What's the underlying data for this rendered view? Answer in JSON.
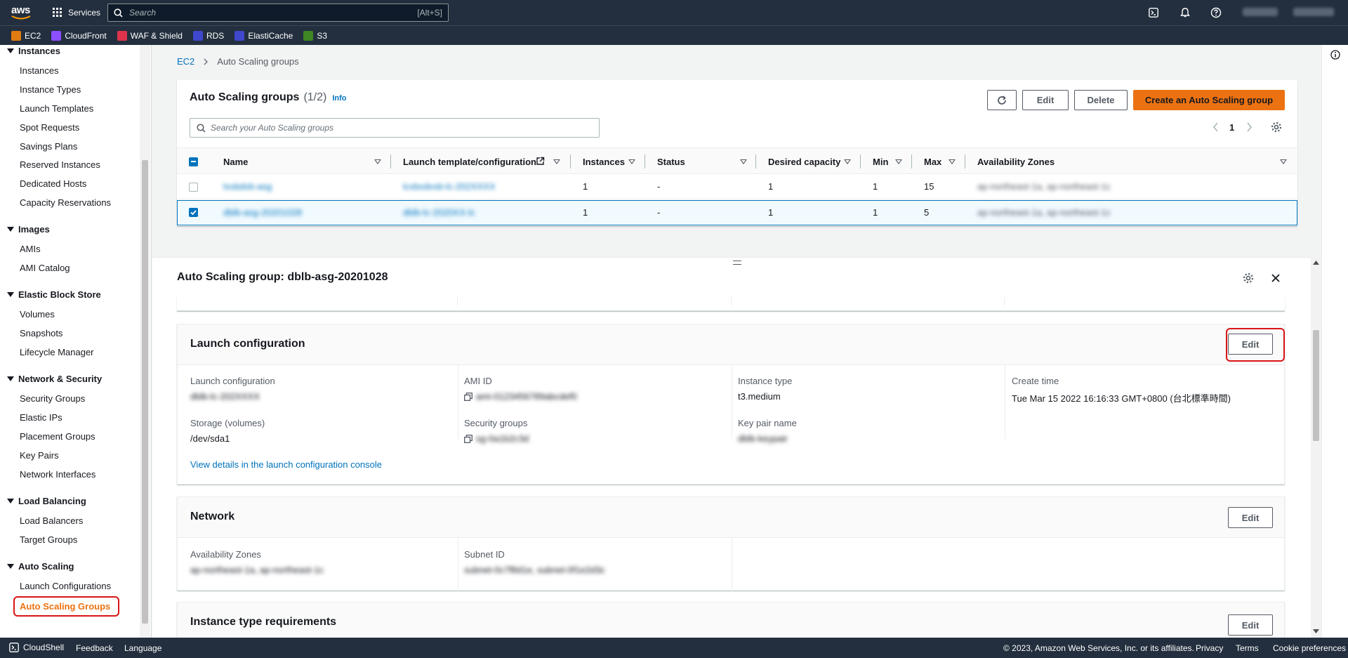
{
  "topnav": {
    "logo": "aws",
    "services_label": "Services",
    "search_placeholder": "Search",
    "search_shortcut": "[Alt+S]",
    "account_name": "",
    "region": ""
  },
  "favorites": [
    {
      "label": "EC2",
      "color": "#e07b12"
    },
    {
      "label": "CloudFront",
      "color": "#8c4fff"
    },
    {
      "label": "WAF & Shield",
      "color": "#dd344c"
    },
    {
      "label": "RDS",
      "color": "#3f48cc"
    },
    {
      "label": "ElastiCache",
      "color": "#3f48cc"
    },
    {
      "label": "S3",
      "color": "#3f8624"
    }
  ],
  "sidebar": {
    "sections": [
      {
        "title": "Instances",
        "items": [
          "Instances",
          "Instance Types",
          "Launch Templates",
          "Spot Requests",
          "Savings Plans",
          "Reserved Instances",
          "Dedicated Hosts",
          "Capacity Reservations"
        ]
      },
      {
        "title": "Images",
        "items": [
          "AMIs",
          "AMI Catalog"
        ]
      },
      {
        "title": "Elastic Block Store",
        "items": [
          "Volumes",
          "Snapshots",
          "Lifecycle Manager"
        ]
      },
      {
        "title": "Network & Security",
        "items": [
          "Security Groups",
          "Elastic IPs",
          "Placement Groups",
          "Key Pairs",
          "Network Interfaces"
        ]
      },
      {
        "title": "Load Balancing",
        "items": [
          "Load Balancers",
          "Target Groups"
        ]
      },
      {
        "title": "Auto Scaling",
        "items": [
          "Launch Configurations",
          "Auto Scaling Groups"
        ]
      }
    ],
    "active_item": "Auto Scaling Groups"
  },
  "breadcrumb": {
    "root": "EC2",
    "current": "Auto Scaling groups"
  },
  "asg_panel": {
    "title": "Auto Scaling groups",
    "count": "(1/2)",
    "info": "Info",
    "edit": "Edit",
    "delete": "Delete",
    "create": "Create an Auto Scaling group",
    "search_placeholder": "Search your Auto Scaling groups",
    "page": "1",
    "columns": [
      "Name",
      "Launch template/configuration",
      "Instances",
      "Status",
      "Desired capacity",
      "Min",
      "Max",
      "Availability Zones"
    ],
    "rows": [
      {
        "name": "lxxbdvb-asg",
        "launch": "lcxbxdvxb-lc-202XXXX",
        "instances": "1",
        "status": "-",
        "desired": "1",
        "min": "1",
        "max": "15",
        "az": "ap-northeast-1a, ap-northeast-1c",
        "selected": false
      },
      {
        "name": "dblb-asg-20201028",
        "launch": "dblb-lc-2020XX-lc",
        "instances": "1",
        "status": "-",
        "desired": "1",
        "min": "1",
        "max": "5",
        "az": "ap-northeast-1a, ap-northeast-1c",
        "selected": true
      }
    ]
  },
  "detail": {
    "title": "Auto Scaling group: dblb-asg-20201028",
    "launch_config": {
      "title": "Launch configuration",
      "edit": "Edit",
      "fields": {
        "launch_configuration_label": "Launch configuration",
        "launch_configuration_value": "dblb-lc-202XXXX",
        "ami_label": "AMI ID",
        "ami_value": "ami-0123456789abcdef0",
        "instance_type_label": "Instance type",
        "instance_type_value": "t3.medium",
        "create_time_label": "Create time",
        "create_time_value": "Tue Mar 15 2022 16:16:33 GMT+0800 (台北標準時間)",
        "storage_label": "Storage (volumes)",
        "storage_value": "/dev/sda1",
        "security_groups_label": "Security groups",
        "security_groups_value": "sg-0a1b2c3d",
        "key_pair_label": "Key pair name",
        "key_pair_value": "dblb-keypair"
      },
      "link": "View details in the launch configuration console"
    },
    "network": {
      "title": "Network",
      "edit": "Edit",
      "az_label": "Availability Zones",
      "az_value": "ap-northeast-1a, ap-northeast-1c",
      "subnet_label": "Subnet ID",
      "subnet_value": "subnet-0c7f8d1e, subnet-0f1e2d3c"
    },
    "instance_type_req": {
      "title": "Instance type requirements",
      "edit": "Edit"
    }
  },
  "footer": {
    "cloudshell": "CloudShell",
    "feedback": "Feedback",
    "language": "Language",
    "copyright": "© 2023, Amazon Web Services, Inc. or its affiliates.",
    "privacy": "Privacy",
    "terms": "Terms",
    "cookies": "Cookie preferences"
  },
  "colors": {
    "accent": "#ec7211",
    "link": "#0073bb",
    "nav": "#232f3e",
    "highlight": "#d91515"
  }
}
